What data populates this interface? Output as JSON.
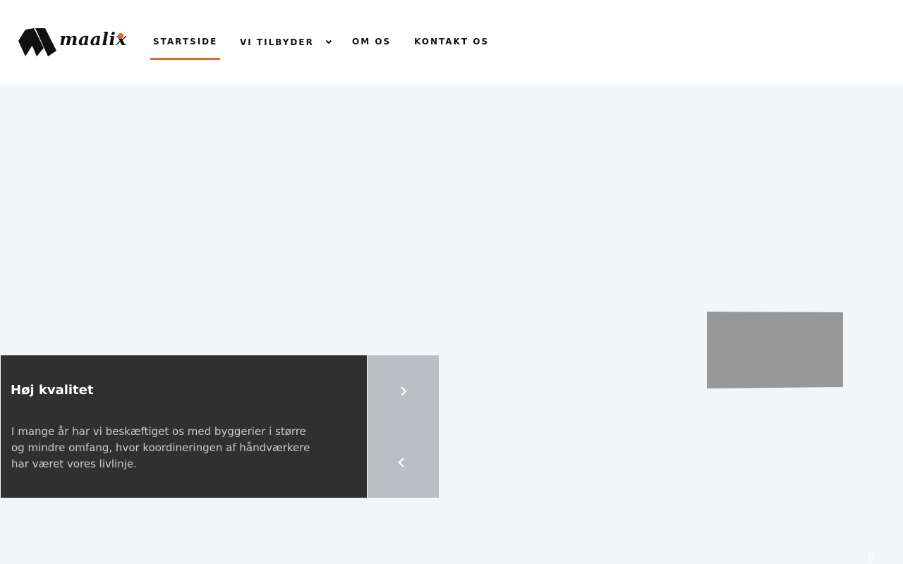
{
  "brand": {
    "name": "maalix",
    "accent_color": "#e8682a",
    "logo_icon": "maalix-stripes-logo"
  },
  "nav": {
    "items": [
      {
        "label": "STARTSIDE",
        "active": true
      },
      {
        "label": "VI TILBYDER",
        "has_dropdown": true,
        "icon": "chevron-down-icon"
      },
      {
        "label": "OM OS"
      },
      {
        "label": "KONTAKT OS"
      }
    ]
  },
  "slider": {
    "caption_title": "Høj kvalitet",
    "caption_text": "I mange år har vi beskæftiget os med byggerier i større og mindre omfang, hvor koordineringen af håndværkere har været vores livlinje.",
    "next_icon": "chevron-right-icon",
    "prev_icon": "chevron-left-icon"
  },
  "colors": {
    "page_background": "#f2f6f9",
    "caption_background": "#303030",
    "arrows_background": "#bbbfc3",
    "image_placeholder": "#989898"
  }
}
